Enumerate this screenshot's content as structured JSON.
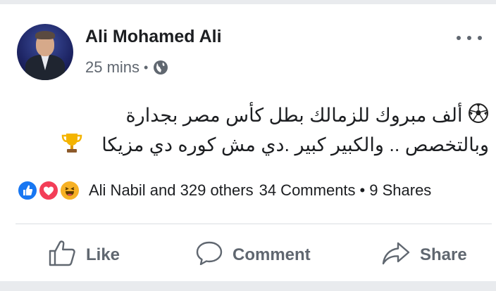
{
  "post": {
    "author": "Ali Mohamed Ali",
    "time": "25 mins",
    "separator": "•",
    "privacy_icon": "globe-icon",
    "text_line1": "ألف مبروك للزمالك بطل كأس مصر بجدارة",
    "text_line2": "وبالتخصص .. والكبير كبير .دي مش كوره دي مزيكا",
    "emoji_line1": "soccer-ball-icon",
    "emoji_line2": "trophy-icon"
  },
  "stats": {
    "reactions": [
      "like-reaction-icon",
      "love-reaction-icon",
      "haha-reaction-icon"
    ],
    "reactors": "Ali Nabil and 329 others",
    "comments": "34 Comments",
    "separator": "•",
    "shares": "9 Shares"
  },
  "actions": {
    "like_label": "Like",
    "comment_label": "Comment",
    "share_label": "Share"
  },
  "colors": {
    "background": "#e9ebee",
    "text": "#1c1e21",
    "secondary": "#606770",
    "like_blue": "#1877f2",
    "love_red": "#f33e58",
    "haha_yellow": "#f7b125"
  }
}
